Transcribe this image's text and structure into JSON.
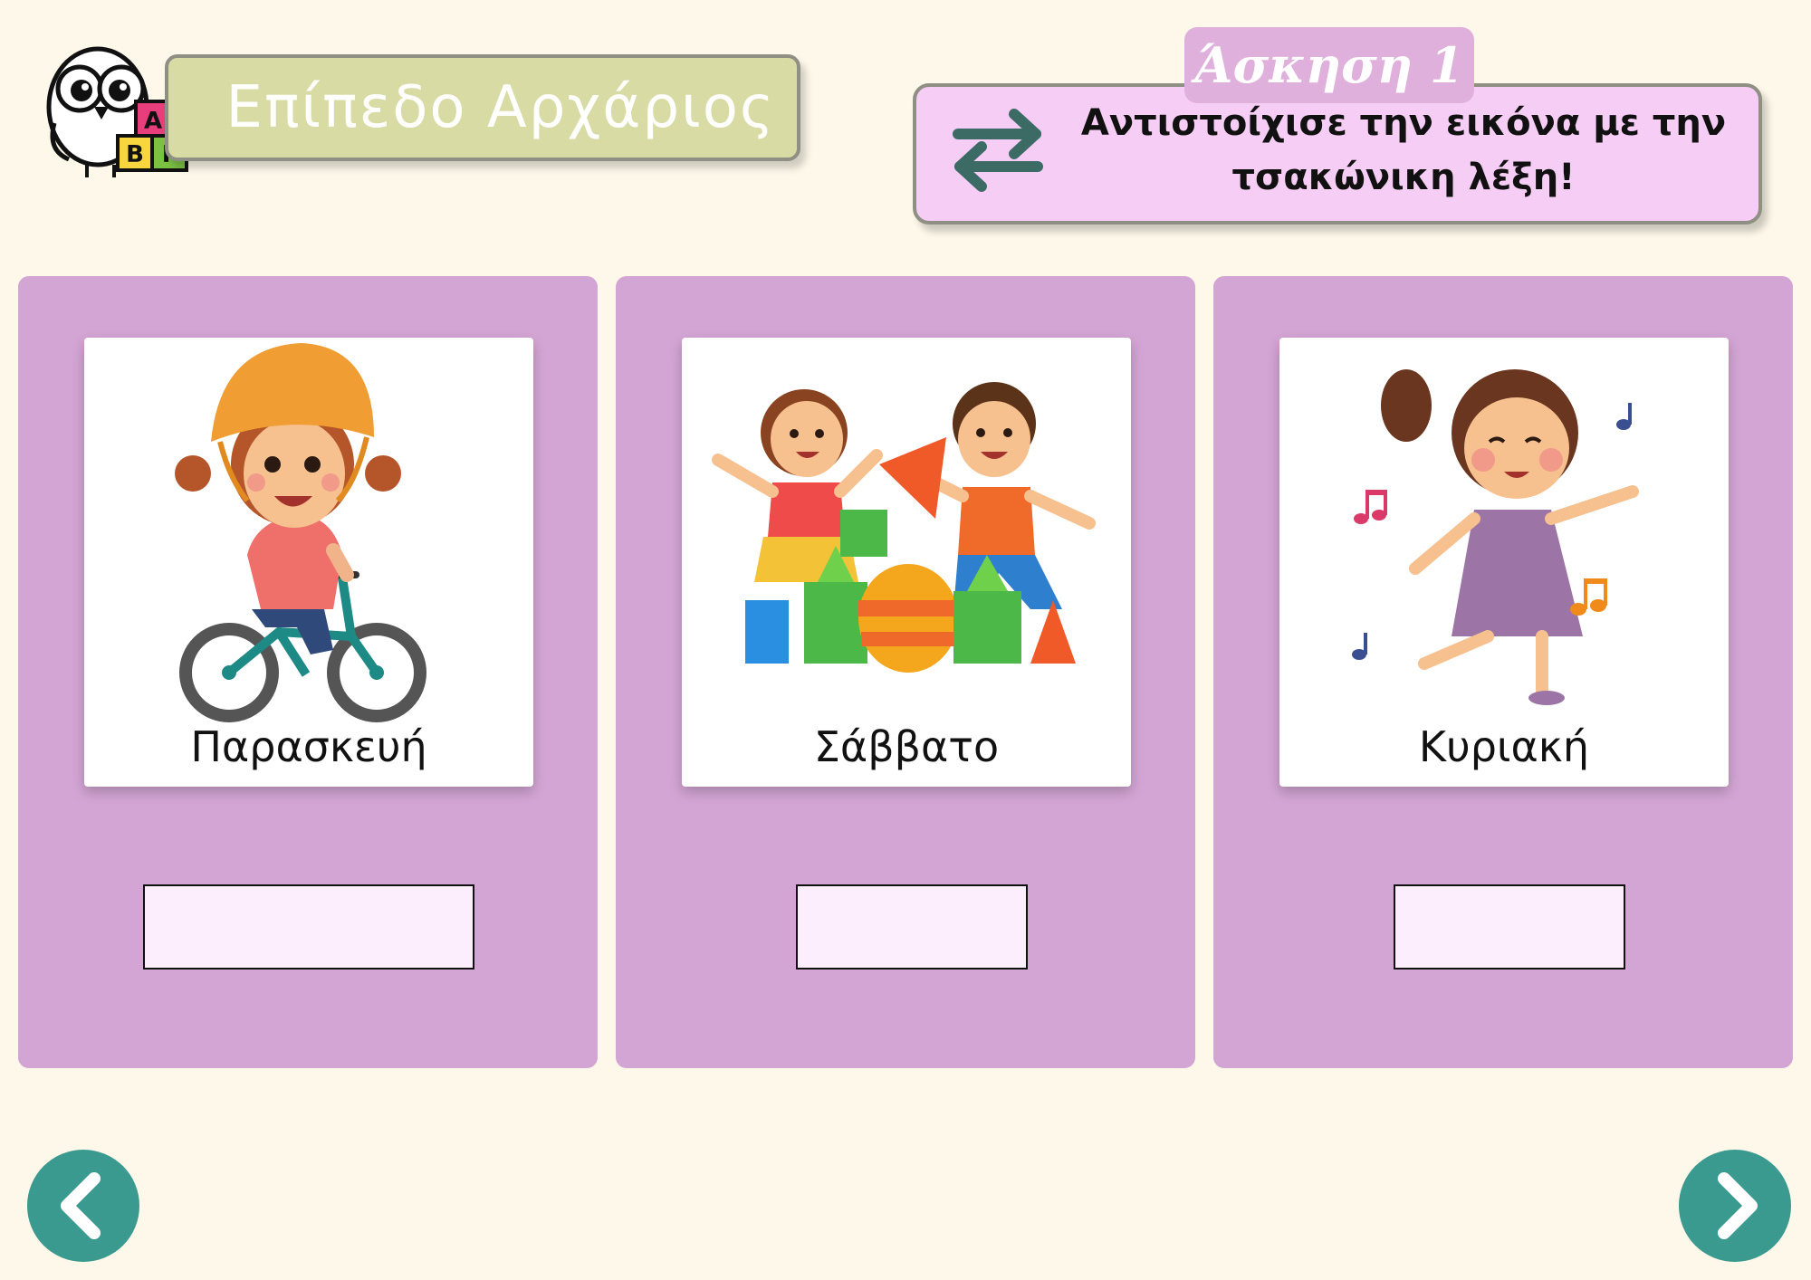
{
  "header": {
    "level_title": "Επίπεδο Αρχάριος",
    "logo_letters": [
      "Α",
      "Β",
      "Γ"
    ]
  },
  "exercise": {
    "title": "Άσκηση 1",
    "instruction": "Αντιστοίχισε την εικόνα με την τσακώνικη λέξη!"
  },
  "cards": [
    {
      "word": "Παρασκευή",
      "image": "girl-on-bicycle",
      "answer": ""
    },
    {
      "word": "Σάββατο",
      "image": "kids-playing-with-blocks",
      "answer": ""
    },
    {
      "word": "Κυριακή",
      "image": "girl-dancing-with-music",
      "answer": ""
    }
  ],
  "navigation": {
    "prev_icon": "chevron-left-icon",
    "next_icon": "chevron-right-icon"
  },
  "colors": {
    "background": "#fdf8e9",
    "card": "#d3a5d4",
    "banner": "#d9dba4",
    "instruction_box": "#f6cdf4",
    "nav_button": "#3a9a8f"
  }
}
